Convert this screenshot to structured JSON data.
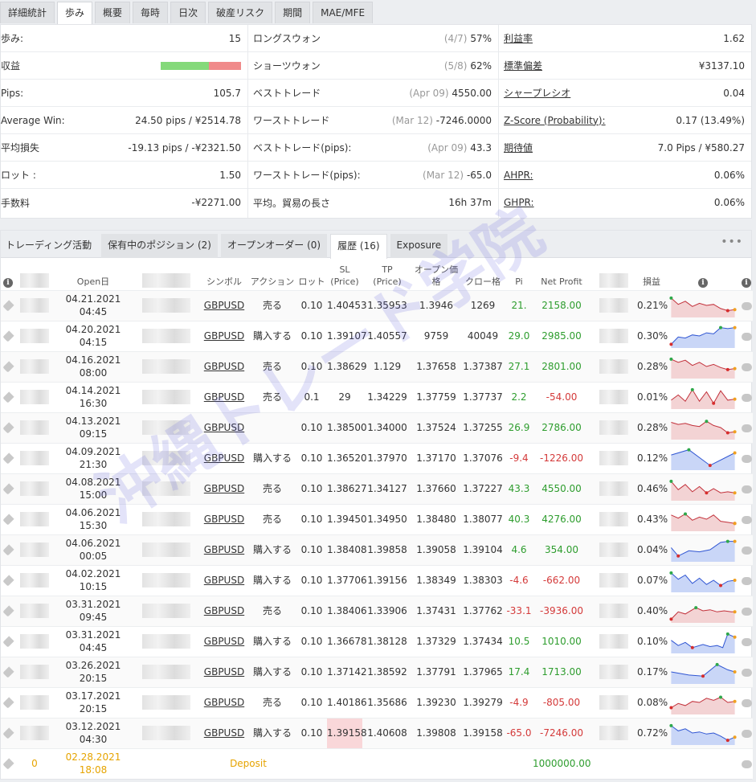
{
  "top_tabs": [
    "詳細統計",
    "歩み",
    "概要",
    "毎時",
    "日次",
    "破産リスク",
    "期間",
    "MAE/MFE"
  ],
  "stats": {
    "col1": [
      {
        "label": "歩み:",
        "value": "15"
      },
      {
        "label": "収益",
        "value": ""
      },
      {
        "label": "Pips:",
        "value": "105.7"
      },
      {
        "label": "Average Win:",
        "value": "24.50 pips / ¥2514.78"
      },
      {
        "label": "平均損失",
        "value": "-19.13 pips / -¥2321.50"
      },
      {
        "label": "ロット :",
        "value": "1.50"
      },
      {
        "label": "手数料",
        "value": "-¥2271.00"
      }
    ],
    "col2": [
      {
        "label": "ロングスウォン",
        "muted": "(4/7)",
        "value": "57%"
      },
      {
        "label": "ショーツウォン",
        "muted": "(5/8)",
        "value": "62%"
      },
      {
        "label": "ベストトレード",
        "muted": "(Apr 09)",
        "value": "4550.00"
      },
      {
        "label": "ワーストトレード",
        "muted": "(Mar 12)",
        "value": "-7246.0000"
      },
      {
        "label": "ベストトレード(pips):",
        "muted": "(Apr 09)",
        "value": "43.3"
      },
      {
        "label": "ワーストトレード(pips):",
        "muted": "(Mar 12)",
        "value": "-65.0"
      },
      {
        "label": "平均。貿易の長さ",
        "muted": "",
        "value": "16h 37m"
      }
    ],
    "col3": [
      {
        "label": "利益率",
        "value": "1.62"
      },
      {
        "label": "標準偏差",
        "value": "¥3137.10"
      },
      {
        "label": "シャープレシオ",
        "value": "0.04"
      },
      {
        "label": "Z-Score (Probability):",
        "value": "0.17 (13.49%)"
      },
      {
        "label": "期待値",
        "value": "7.0 Pips / ¥580.27"
      },
      {
        "label": "AHPR:",
        "value": "0.06%"
      },
      {
        "label": "GHPR:",
        "value": "0.06%"
      }
    ],
    "profit_bar": {
      "win_fraction": 0.6,
      "win_color": "#84d97a",
      "loss_color": "#f08a8a"
    }
  },
  "panel_tabs": [
    "トレーディング活動",
    "保有中のポジション (2)",
    "オープンオーダー (0)",
    "履歴 (16)",
    "Exposure"
  ],
  "columns": {
    "open": "Open日",
    "symbol": "シンボル",
    "action": "アクション",
    "lots": "ロット",
    "sl": "SL",
    "sl_sub": "(Price)",
    "tp": "TP",
    "tp_sub": "(Price)",
    "open_price": "オープン価格",
    "close_price": "クロー格",
    "pips": "Pi",
    "net": "Net Profit",
    "gain": "損益"
  },
  "rows": [
    {
      "date": "04.21.2021",
      "time": "04:45",
      "symbol": "GBPUSD",
      "action": "売る",
      "lots": "0.10",
      "sl": "1.40453",
      "tp": "1.35953",
      "open": "1.3946",
      "close": "1269",
      "pips": "21.",
      "net": "2158.00",
      "gain": "0.21%",
      "sign": "pos",
      "spark": [
        [
          0.05,
          0.85
        ],
        [
          0.15,
          0.55
        ],
        [
          0.25,
          0.7
        ],
        [
          0.35,
          0.45
        ],
        [
          0.45,
          0.6
        ],
        [
          0.55,
          0.5
        ],
        [
          0.65,
          0.55
        ],
        [
          0.75,
          0.35
        ],
        [
          0.85,
          0.25
        ],
        [
          0.95,
          0.3
        ]
      ],
      "trend": "down"
    },
    {
      "date": "04.20.2021",
      "time": "04:15",
      "symbol": "GBPUSD",
      "action": "購入する",
      "lots": "0.10",
      "sl": "1.39107",
      "tp": "1.40557",
      "open": "9759",
      "close": "40049",
      "pips": "29.0",
      "net": "2985.00",
      "gain": "0.30%",
      "sign": "pos",
      "spark": [
        [
          0.05,
          0.1
        ],
        [
          0.15,
          0.45
        ],
        [
          0.25,
          0.4
        ],
        [
          0.35,
          0.55
        ],
        [
          0.45,
          0.5
        ],
        [
          0.55,
          0.65
        ],
        [
          0.65,
          0.6
        ],
        [
          0.75,
          0.9
        ],
        [
          0.85,
          0.85
        ],
        [
          0.95,
          0.9
        ]
      ],
      "trend": "up"
    },
    {
      "date": "04.16.2021",
      "time": "08:00",
      "symbol": "GBPUSD",
      "action": "売る",
      "lots": "0.10",
      "sl": "1.38629",
      "tp": "1.129",
      "open": "1.37658",
      "close": "1.37387",
      "pips": "27.1",
      "net": "2801.00",
      "gain": "0.28%",
      "sign": "pos",
      "spark": [
        [
          0.05,
          0.85
        ],
        [
          0.15,
          0.7
        ],
        [
          0.25,
          0.8
        ],
        [
          0.35,
          0.55
        ],
        [
          0.45,
          0.7
        ],
        [
          0.55,
          0.5
        ],
        [
          0.65,
          0.6
        ],
        [
          0.75,
          0.45
        ],
        [
          0.85,
          0.35
        ],
        [
          0.95,
          0.4
        ]
      ],
      "trend": "down"
    },
    {
      "date": "04.14.2021",
      "time": "16:30",
      "symbol": "GBPUSD",
      "action": "売る",
      "lots": "0.1",
      "sl": "29",
      "tp": "1.34229",
      "open": "1.37759",
      "close": "1.37737",
      "pips": "2.2",
      "net": "-54.00",
      "gain": "0.01%",
      "sign": "neg",
      "spark": [
        [
          0.05,
          0.35
        ],
        [
          0.15,
          0.6
        ],
        [
          0.25,
          0.3
        ],
        [
          0.35,
          0.85
        ],
        [
          0.45,
          0.3
        ],
        [
          0.55,
          0.75
        ],
        [
          0.65,
          0.2
        ],
        [
          0.75,
          0.8
        ],
        [
          0.85,
          0.35
        ],
        [
          0.95,
          0.4
        ]
      ],
      "trend": "down"
    },
    {
      "date": "04.13.2021",
      "time": "09:15",
      "symbol": "GBPUSD",
      "action": "",
      "lots": "0.10",
      "sl": "1.38500",
      "tp": "1.34000",
      "open": "1.37524",
      "close": "1.37255",
      "pips": "26.9",
      "net": "2786.00",
      "gain": "0.28%",
      "sign": "pos",
      "spark": [
        [
          0.05,
          0.75
        ],
        [
          0.15,
          0.65
        ],
        [
          0.25,
          0.7
        ],
        [
          0.35,
          0.6
        ],
        [
          0.45,
          0.55
        ],
        [
          0.55,
          0.8
        ],
        [
          0.65,
          0.6
        ],
        [
          0.75,
          0.5
        ],
        [
          0.85,
          0.25
        ],
        [
          0.95,
          0.3
        ]
      ],
      "trend": "down"
    },
    {
      "date": "04.09.2021",
      "time": "21:30",
      "symbol": "GBPUSD",
      "action": "購入する",
      "lots": "0.10",
      "sl": "1.36520",
      "tp": "1.37970",
      "open": "1.37170",
      "close": "1.37076",
      "pips": "-9.4",
      "net": "-1226.00",
      "gain": "0.12%",
      "sign": "neg",
      "spark": [
        [
          0.05,
          0.65
        ],
        [
          0.3,
          0.9
        ],
        [
          0.6,
          0.15
        ],
        [
          0.95,
          0.75
        ]
      ],
      "trend": "up"
    },
    {
      "date": "04.08.2021",
      "time": "15:00",
      "symbol": "GBPUSD",
      "action": "売る",
      "lots": "0.10",
      "sl": "1.38627",
      "tp": "1.34127",
      "open": "1.37660",
      "close": "1.37227",
      "pips": "43.3",
      "net": "4550.00",
      "gain": "0.46%",
      "sign": "pos",
      "spark": [
        [
          0.05,
          0.85
        ],
        [
          0.15,
          0.45
        ],
        [
          0.25,
          0.7
        ],
        [
          0.35,
          0.35
        ],
        [
          0.45,
          0.6
        ],
        [
          0.55,
          0.3
        ],
        [
          0.65,
          0.5
        ],
        [
          0.75,
          0.3
        ],
        [
          0.85,
          0.35
        ],
        [
          0.95,
          0.3
        ]
      ],
      "trend": "down"
    },
    {
      "date": "04.06.2021",
      "time": "15:30",
      "symbol": "GBPUSD",
      "action": "売る",
      "lots": "0.10",
      "sl": "1.39450",
      "tp": "1.34950",
      "open": "1.38480",
      "close": "1.38077",
      "pips": "40.3",
      "net": "4276.00",
      "gain": "0.43%",
      "sign": "pos",
      "spark": [
        [
          0.05,
          0.7
        ],
        [
          0.15,
          0.55
        ],
        [
          0.25,
          0.75
        ],
        [
          0.35,
          0.45
        ],
        [
          0.45,
          0.6
        ],
        [
          0.55,
          0.5
        ],
        [
          0.65,
          0.7
        ],
        [
          0.75,
          0.4
        ],
        [
          0.85,
          0.35
        ],
        [
          0.95,
          0.3
        ]
      ],
      "trend": "down"
    },
    {
      "date": "04.06.2021",
      "time": "00:05",
      "symbol": "GBPUSD",
      "action": "購入する",
      "lots": "0.10",
      "sl": "1.38408",
      "tp": "1.39858",
      "open": "1.39058",
      "close": "1.39104",
      "pips": "4.6",
      "net": "354.00",
      "gain": "0.04%",
      "sign": "pos",
      "spark": [
        [
          0.05,
          0.6
        ],
        [
          0.15,
          0.2
        ],
        [
          0.3,
          0.45
        ],
        [
          0.45,
          0.4
        ],
        [
          0.6,
          0.5
        ],
        [
          0.75,
          0.85
        ],
        [
          0.85,
          0.9
        ],
        [
          0.95,
          0.9
        ]
      ],
      "trend": "up"
    },
    {
      "date": "04.02.2021",
      "time": "10:15",
      "symbol": "GBPUSD",
      "action": "購入する",
      "lots": "0.10",
      "sl": "1.37706",
      "tp": "1.39156",
      "open": "1.38349",
      "close": "1.38303",
      "pips": "-4.6",
      "net": "-662.00",
      "gain": "0.07%",
      "sign": "neg",
      "spark": [
        [
          0.05,
          0.85
        ],
        [
          0.15,
          0.55
        ],
        [
          0.25,
          0.75
        ],
        [
          0.35,
          0.35
        ],
        [
          0.45,
          0.6
        ],
        [
          0.55,
          0.3
        ],
        [
          0.65,
          0.5
        ],
        [
          0.75,
          0.25
        ],
        [
          0.85,
          0.45
        ],
        [
          0.95,
          0.5
        ]
      ],
      "trend": "up"
    },
    {
      "date": "03.31.2021",
      "time": "09:45",
      "symbol": "GBPUSD",
      "action": "売る",
      "lots": "0.10",
      "sl": "1.38406",
      "tp": "1.33906",
      "open": "1.37431",
      "close": "1.37762",
      "pips": "-33.1",
      "net": "-3936.00",
      "gain": "0.40%",
      "sign": "neg",
      "spark": [
        [
          0.05,
          0.1
        ],
        [
          0.15,
          0.45
        ],
        [
          0.25,
          0.35
        ],
        [
          0.4,
          0.65
        ],
        [
          0.5,
          0.5
        ],
        [
          0.6,
          0.55
        ],
        [
          0.7,
          0.45
        ],
        [
          0.8,
          0.5
        ],
        [
          0.9,
          0.45
        ],
        [
          0.95,
          0.45
        ]
      ],
      "trend": "down"
    },
    {
      "date": "03.31.2021",
      "time": "04:45",
      "symbol": "GBPUSD",
      "action": "購入する",
      "lots": "0.10",
      "sl": "1.36678",
      "tp": "1.38128",
      "open": "1.37329",
      "close": "1.37434",
      "pips": "10.5",
      "net": "1010.00",
      "gain": "0.10%",
      "sign": "pos",
      "spark": [
        [
          0.05,
          0.55
        ],
        [
          0.15,
          0.3
        ],
        [
          0.25,
          0.45
        ],
        [
          0.35,
          0.2
        ],
        [
          0.5,
          0.35
        ],
        [
          0.6,
          0.25
        ],
        [
          0.7,
          0.3
        ],
        [
          0.78,
          0.2
        ],
        [
          0.85,
          0.85
        ],
        [
          0.95,
          0.7
        ]
      ],
      "trend": "up"
    },
    {
      "date": "03.26.2021",
      "time": "20:15",
      "symbol": "GBPUSD",
      "action": "購入する",
      "lots": "0.10",
      "sl": "1.37142",
      "tp": "1.38592",
      "open": "1.37791",
      "close": "1.37965",
      "pips": "17.4",
      "net": "1713.00",
      "gain": "0.17%",
      "sign": "pos",
      "spark": [
        [
          0.05,
          0.5
        ],
        [
          0.3,
          0.35
        ],
        [
          0.5,
          0.3
        ],
        [
          0.7,
          0.85
        ],
        [
          0.85,
          0.6
        ],
        [
          0.95,
          0.5
        ]
      ],
      "trend": "up"
    },
    {
      "date": "03.17.2021",
      "time": "20:15",
      "symbol": "GBPUSD",
      "action": "売る",
      "lots": "0.10",
      "sl": "1.40186",
      "tp": "1.35686",
      "open": "1.39230",
      "close": "1.39279",
      "pips": "-4.9",
      "net": "-805.00",
      "gain": "0.08%",
      "sign": "neg",
      "spark": [
        [
          0.05,
          0.25
        ],
        [
          0.15,
          0.45
        ],
        [
          0.25,
          0.35
        ],
        [
          0.35,
          0.55
        ],
        [
          0.45,
          0.5
        ],
        [
          0.55,
          0.7
        ],
        [
          0.65,
          0.6
        ],
        [
          0.75,
          0.75
        ],
        [
          0.85,
          0.5
        ],
        [
          0.95,
          0.55
        ]
      ],
      "trend": "down"
    },
    {
      "date": "03.12.2021",
      "time": "04:30",
      "symbol": "GBPUSD",
      "action": "購入する",
      "lots": "0.10",
      "sl": "1.39158",
      "tp": "1.40608",
      "open": "1.39808",
      "close": "1.39158",
      "pips": "-65.0",
      "net": "-7246.00",
      "gain": "0.72%",
      "sign": "neg",
      "sl_hit": true,
      "spark": [
        [
          0.05,
          0.85
        ],
        [
          0.15,
          0.6
        ],
        [
          0.25,
          0.7
        ],
        [
          0.35,
          0.5
        ],
        [
          0.45,
          0.55
        ],
        [
          0.55,
          0.45
        ],
        [
          0.65,
          0.5
        ],
        [
          0.75,
          0.35
        ],
        [
          0.85,
          0.15
        ],
        [
          0.95,
          0.3
        ]
      ],
      "trend": "up"
    }
  ],
  "deposit": {
    "count": "0",
    "date": "02.28.2021",
    "time": "18:08",
    "label": "Deposit",
    "amount": "1000000.00"
  },
  "watermark": "沖縄トレード学院",
  "colors": {
    "positive": "#2e9d2e",
    "negative": "#d43a3a",
    "up_fill": "#c9d6f7",
    "up_line": "#3056d3",
    "down_fill": "#f3d3d4",
    "down_line": "#c2303a",
    "deposit": "#e6a400"
  }
}
